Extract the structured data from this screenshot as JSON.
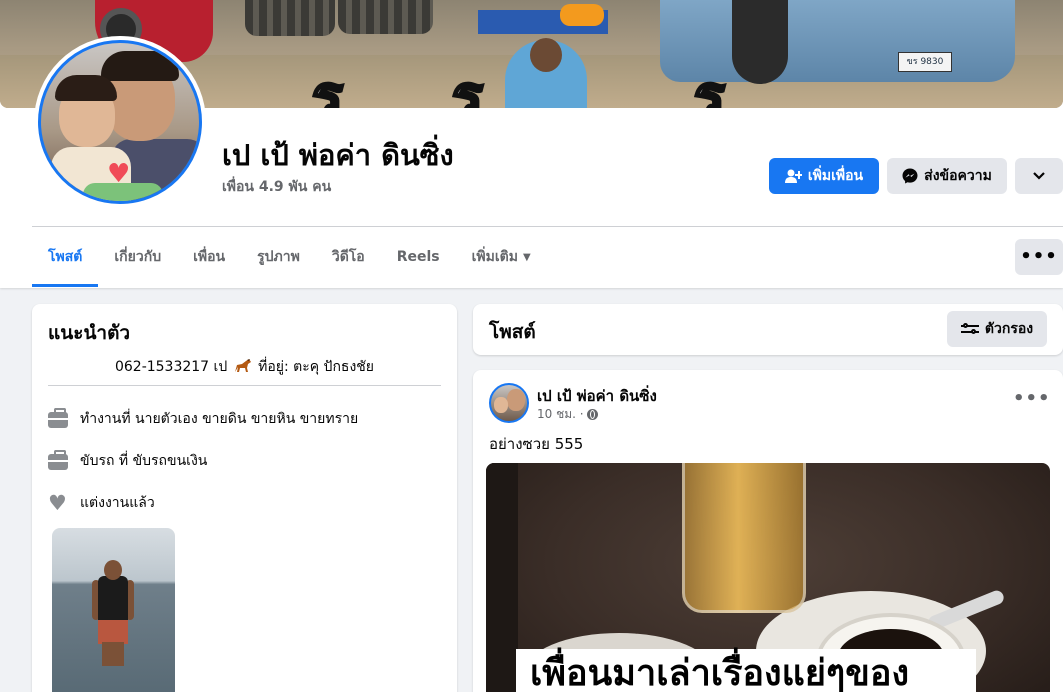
{
  "cover": {
    "plate_text": "ขร 9830",
    "overlay_chars": [
      "ร",
      "ร",
      "ร"
    ]
  },
  "profile": {
    "name": "เป เป้ พ่อค่า ดินซิ่ง",
    "friends_count": "เพื่อน 4.9 พัน คน"
  },
  "actions": {
    "add_friend": "เพิ่มเพื่อน",
    "message": "ส่งข้อความ",
    "more_icon": "chevron-down-icon"
  },
  "tabs": [
    {
      "label": "โพสต์",
      "active": true
    },
    {
      "label": "เกี่ยวกับ",
      "active": false
    },
    {
      "label": "เพื่อน",
      "active": false
    },
    {
      "label": "รูปภาพ",
      "active": false
    },
    {
      "label": "วิดีโอ",
      "active": false
    },
    {
      "label": "Reels",
      "active": false
    },
    {
      "label": "เพิ่มเติม",
      "active": false
    }
  ],
  "intro": {
    "title": "แนะนำตัว",
    "bio_before": "062-1533217 เป",
    "bio_after": "ที่อยู่: ตะคุ ปักธงชัย",
    "rows": [
      {
        "icon": "briefcase-icon",
        "text": "ทำงานที่ นายตัวเอง ขายดิน ขายหิน ขายทราย"
      },
      {
        "icon": "briefcase-icon",
        "text": "ขับรถ ที่ ขับรถขนเงิน"
      },
      {
        "icon": "heart-icon",
        "text": "แต่งงานแล้ว"
      }
    ]
  },
  "posts_section": {
    "title": "โพสต์",
    "filter_label": "ตัวกรอง"
  },
  "post": {
    "author": "เป เป้ พ่อค่า ดินซิ่ง",
    "time": "10 ชม. ·",
    "text": "อย่างซวย 555",
    "image_caption": "เพื่อนมาเล่าเรื่องแย่ๆของ"
  },
  "colors": {
    "accent": "#1877f2",
    "background": "#f0f2f5",
    "secondary_button": "#e4e6eb",
    "muted_text": "#65676b"
  }
}
